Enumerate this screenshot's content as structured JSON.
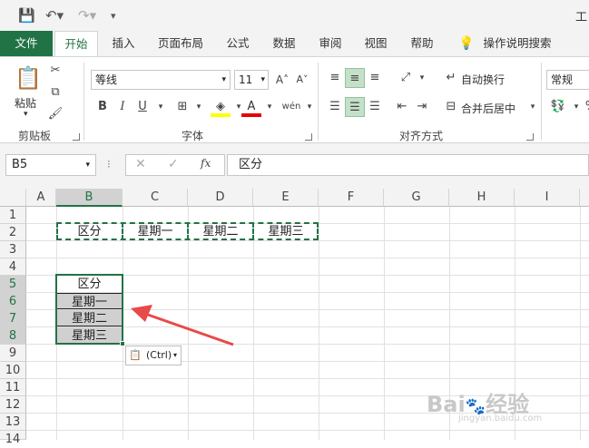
{
  "titlebar": {
    "title": "工"
  },
  "tabs": [
    "文件",
    "开始",
    "插入",
    "页面布局",
    "公式",
    "数据",
    "审阅",
    "视图",
    "帮助",
    "操作说明搜索"
  ],
  "ribbon": {
    "paste_label": "粘贴",
    "clipboard_group": "剪贴板",
    "font_name": "等线",
    "font_size": "11",
    "font_group": "字体",
    "bold": "B",
    "italic": "I",
    "underline": "U",
    "wrap_text": "自动换行",
    "merge_center": "合并后居中",
    "alignment_group": "对齐方式",
    "number_format": "常规"
  },
  "formula_bar": {
    "name_box": "B5",
    "formula": "区分"
  },
  "grid": {
    "columns": [
      "A",
      "B",
      "C",
      "D",
      "E",
      "F",
      "G",
      "H",
      "I"
    ],
    "rows": [
      "1",
      "2",
      "3",
      "4",
      "5",
      "6",
      "7",
      "8",
      "9",
      "10",
      "11",
      "12",
      "13",
      "14"
    ],
    "row2": [
      "区分",
      "星期一",
      "星期二",
      "星期三"
    ],
    "colB": [
      "区分",
      "星期一",
      "星期二",
      "星期三"
    ]
  },
  "paste_options": {
    "label": "(Ctrl)"
  },
  "colors": {
    "accent": "#217346",
    "selection_fill": "#d0d0d0",
    "arrow": "#e84a4a"
  }
}
